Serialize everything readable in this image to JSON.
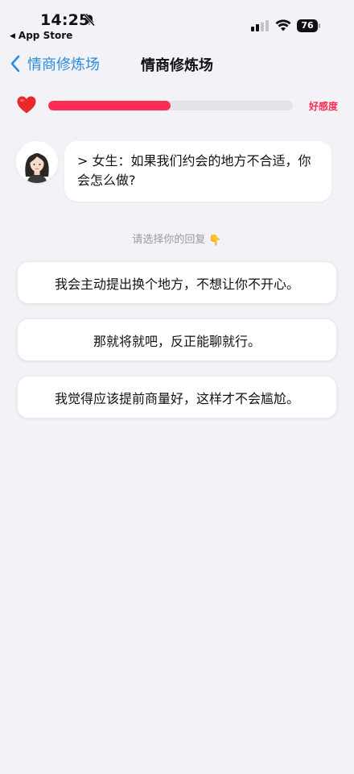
{
  "status_bar": {
    "time": "14:25",
    "back_app_label": "App Store",
    "battery": "76",
    "icons": [
      "bell-slash-icon",
      "cellular-signal-icon",
      "wifi-icon",
      "battery-icon"
    ]
  },
  "nav": {
    "back_label": "情商修炼场",
    "title": "情商修炼场"
  },
  "favor": {
    "label": "好感度",
    "level": 0.5,
    "color": "#ff2d55"
  },
  "message": {
    "text": "> 女生：如果我们约会的地方不合适，你会怎么做?"
  },
  "prompt": {
    "text": "请选择你的回复",
    "emoji": "👇"
  },
  "options": [
    {
      "text": "我会主动提出换个地方，不想让你不开心。"
    },
    {
      "text": "那就将就吧，反正能聊就行。"
    },
    {
      "text": "我觉得应该提前商量好，这样才不会尴尬。"
    }
  ],
  "colors": {
    "accent": "#2a8de0",
    "background": "#f2f2f7",
    "favor": "#ff2d55"
  }
}
